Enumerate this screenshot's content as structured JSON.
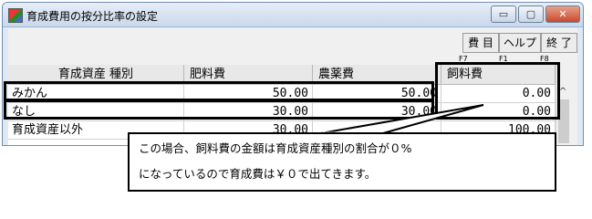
{
  "window": {
    "title": "育成費用の按分比率の設定",
    "minimize_glyph": "▭",
    "maximize_glyph": "▢",
    "close_glyph": "✕"
  },
  "toolbar": {
    "buttons": [
      {
        "label": "費 目",
        "key": "F7"
      },
      {
        "label": "ヘルプ",
        "key": "F1"
      },
      {
        "label": "終 了",
        "key": "F8"
      }
    ]
  },
  "table": {
    "columns": [
      "育成資産 種別",
      "肥料費",
      "農薬費",
      "飼料費"
    ],
    "rows": [
      {
        "type": "みかん",
        "fertilizer": "50.00",
        "pesticide": "50.00",
        "feed": "0.00"
      },
      {
        "type": "なし",
        "fertilizer": "30.00",
        "pesticide": "30.00",
        "feed": "0.00"
      },
      {
        "type": "育成資産以外",
        "fertilizer": "30.00",
        "pesticide": "",
        "feed": "100.00"
      }
    ],
    "scroll_up_glyph": "^"
  },
  "callout": {
    "line1": "この場合、飼料費の金額は育成資産種別の割合が０%",
    "line2": "になっているので育成費は￥０で出てきます。"
  },
  "colors": {
    "title_bar": "#c9d8ea",
    "highlight": "#000000"
  }
}
